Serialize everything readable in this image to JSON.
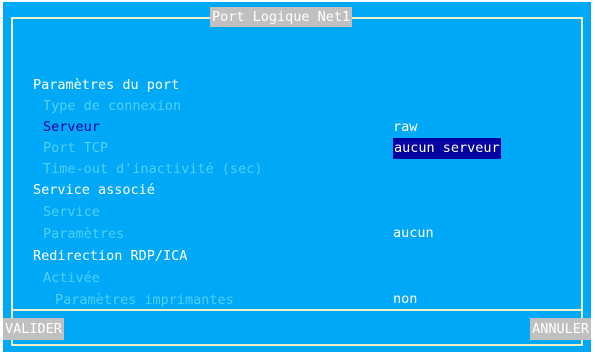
{
  "window": {
    "title": "Port Logique Net1"
  },
  "sections": {
    "port_params": "Paramètres du port",
    "connection_type": {
      "label": "Type de connexion",
      "value": "raw"
    },
    "server": {
      "label": "Serveur",
      "value": "aucun serveur"
    },
    "tcp_port": {
      "label": "Port TCP"
    },
    "timeout": {
      "label": "Time-out d'inactivité (sec)"
    },
    "assoc_service": "Service associé",
    "service": {
      "label": "Service",
      "value": "aucun"
    },
    "service_params": {
      "label": "Paramètres"
    },
    "redirection": "Redirection RDP/ICA",
    "enabled": {
      "label": "Activée",
      "value": "non"
    },
    "printer_params": {
      "label": "Paramètres imprimantes"
    }
  },
  "buttons": {
    "ok": "VALIDER",
    "cancel": "ANNULER"
  },
  "colors": {
    "background": "#00a8f8",
    "frame": "#f0f0c8",
    "header_text": "#ffffff",
    "disabled_text": "#4ed0f8",
    "focused_label": "#0000a0",
    "selection_bg": "#0000a0",
    "button_bg": "#c0c0c0"
  }
}
